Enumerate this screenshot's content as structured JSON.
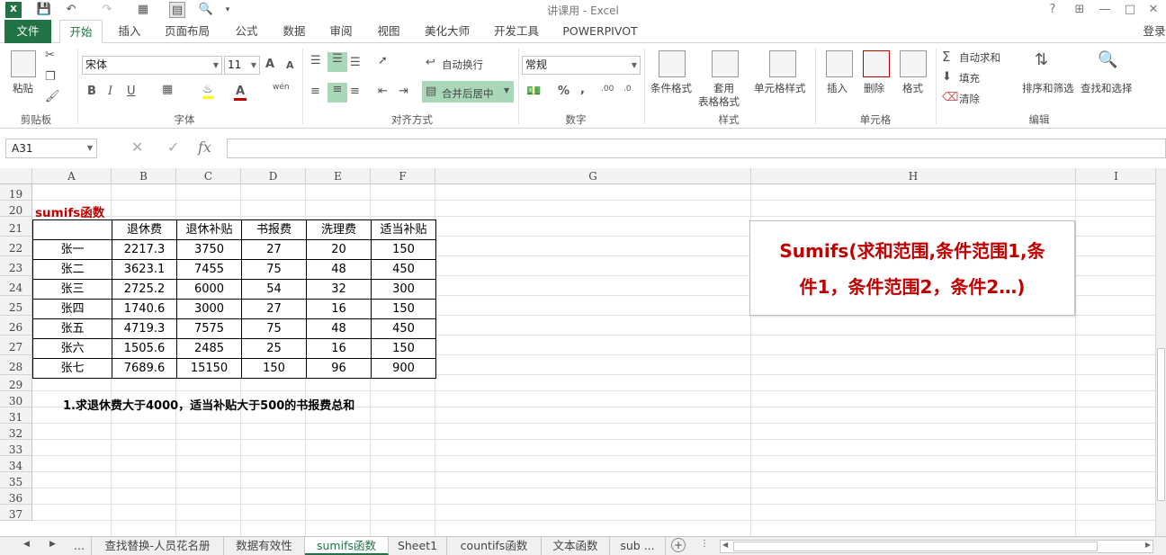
{
  "window": {
    "title": "讲课用 - Excel",
    "help": "?",
    "minimize": "—",
    "restore": "□",
    "close": "✕"
  },
  "ribbon_tabs": [
    "文件",
    "开始",
    "插入",
    "页面布局",
    "公式",
    "数据",
    "审阅",
    "视图",
    "美化大师",
    "开发工具",
    "POWERPIVOT"
  ],
  "login": "登录",
  "clipboard": {
    "paste": "粘贴",
    "group": "剪贴板"
  },
  "font": {
    "name": "宋体",
    "size": "11",
    "group": "字体",
    "bold": "B",
    "italic": "I",
    "underline": "U",
    "grow": "A",
    "shrink": "A",
    "fontcolor": "A",
    "wen": "wén"
  },
  "alignment": {
    "wrap": "自动换行",
    "merge": "合并后居中",
    "group": "对齐方式"
  },
  "number": {
    "format": "常规",
    "group": "数字",
    "percent": "%",
    "comma": ","
  },
  "styles": {
    "cond": "条件格式",
    "table1": "套用",
    "table2": "表格格式",
    "cell": "单元格样式",
    "group": "样式"
  },
  "cells": {
    "insert": "插入",
    "delete": "删除",
    "format": "格式",
    "group": "单元格"
  },
  "editing": {
    "autosum": "自动求和",
    "fill": "填充",
    "clear": "清除",
    "sort": "排序和筛选",
    "find": "查找和选择",
    "group": "编辑"
  },
  "formula_bar": {
    "name_box": "A31",
    "fx": "fx",
    "cancel": "✕",
    "enter": "✓",
    "value": ""
  },
  "columns": [
    "A",
    "B",
    "C",
    "D",
    "E",
    "F",
    "G",
    "H",
    "I"
  ],
  "rows": [
    "19",
    "20",
    "21",
    "22",
    "23",
    "24",
    "25",
    "26",
    "27",
    "28",
    "29",
    "30",
    "31",
    "32",
    "33",
    "34",
    "35",
    "36",
    "37"
  ],
  "sheet": {
    "title": "sumifs函数",
    "headers": [
      "",
      "退休费",
      "退休补贴",
      "书报费",
      "洗理费",
      "适当补贴"
    ],
    "data": [
      [
        "张一",
        "2217.3",
        "3750",
        "27",
        "20",
        "150"
      ],
      [
        "张二",
        "3623.1",
        "7455",
        "75",
        "48",
        "450"
      ],
      [
        "张三",
        "2725.2",
        "6000",
        "54",
        "32",
        "300"
      ],
      [
        "张四",
        "1740.6",
        "3000",
        "27",
        "16",
        "150"
      ],
      [
        "张五",
        "4719.3",
        "7575",
        "75",
        "48",
        "450"
      ],
      [
        "张六",
        "1505.6",
        "2485",
        "25",
        "16",
        "150"
      ],
      [
        "张七",
        "7689.6",
        "15150",
        "150",
        "96",
        "900"
      ]
    ],
    "question": "1.求退休费大于4000，适当补贴大于500的书报费总和",
    "formula_box_line1": "Sumifs(求和范围,条件范围1,条",
    "formula_box_line2": "件1，条件范围2，条件2…)"
  },
  "sheet_tabs": [
    "...",
    "查找替换-人员花名册",
    "数据有效性",
    "sumifs函数",
    "Sheet1",
    "countifs函数",
    "文本函数",
    "sub ..."
  ],
  "accent": "#217346",
  "title_red": "#c00000"
}
